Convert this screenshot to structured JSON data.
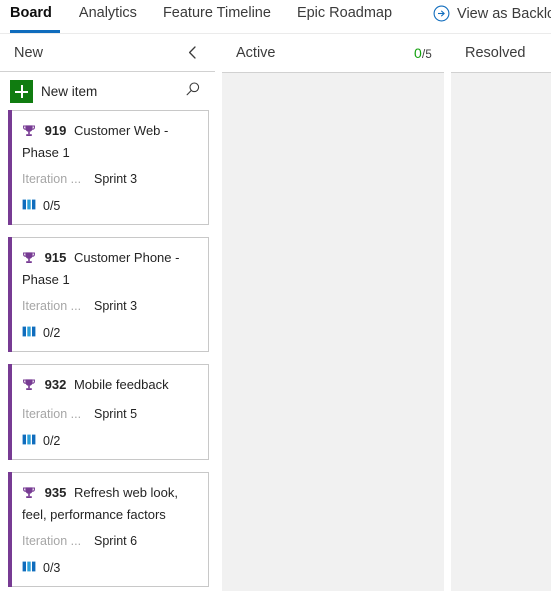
{
  "nav": {
    "tabs": [
      {
        "label": "Board",
        "active": true
      },
      {
        "label": "Analytics",
        "active": false
      },
      {
        "label": "Feature Timeline",
        "active": false
      },
      {
        "label": "Epic Roadmap",
        "active": false
      }
    ],
    "action": {
      "label": "View as Backlog",
      "icon": "circled-arrow-right-icon",
      "color": "#0f6cbd"
    }
  },
  "toolbar": {
    "new_item_label": "New item",
    "new_item_icon": "plus-icon",
    "new_item_color": "#107c10",
    "search_icon": "search-icon"
  },
  "columns": [
    {
      "name": "new",
      "title": "New",
      "limit": null,
      "collapse_icon": "chevron-left-icon",
      "collapsible": true
    },
    {
      "name": "active",
      "title": "Active",
      "limit": {
        "current": "0",
        "separator": "/",
        "total": "5",
        "current_color": "#13a10e"
      },
      "collapsible": false
    },
    {
      "name": "resolved",
      "title": "Resolved",
      "limit": null,
      "collapsible": false
    }
  ],
  "cards": [
    {
      "type_icon": "trophy-icon",
      "type_color": "#773b93",
      "id": "919",
      "title": "Customer Web - Phase 1",
      "field_label": "Iteration ...",
      "field_value": "Sprint 3",
      "count_icon": "stacked-bars-icon",
      "count": "0/5"
    },
    {
      "type_icon": "trophy-icon",
      "type_color": "#773b93",
      "id": "915",
      "title": "Customer Phone - Phase 1",
      "field_label": "Iteration ...",
      "field_value": "Sprint 3",
      "count_icon": "stacked-bars-icon",
      "count": "0/2"
    },
    {
      "type_icon": "trophy-icon",
      "type_color": "#773b93",
      "id": "932",
      "title": "Mobile feedback",
      "field_label": "Iteration ...",
      "field_value": "Sprint 5",
      "count_icon": "stacked-bars-icon",
      "count": "0/2"
    },
    {
      "type_icon": "trophy-icon",
      "type_color": "#773b93",
      "id": "935",
      "title": "Refresh web look, feel, performance factors",
      "field_label": "Iteration ...",
      "field_value": "Sprint 6",
      "count_icon": "stacked-bars-icon",
      "count": "0/3"
    }
  ]
}
